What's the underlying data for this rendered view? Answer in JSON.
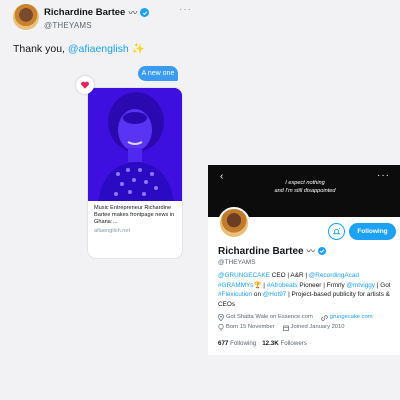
{
  "tweet": {
    "author_name": "Richardine Bartee",
    "author_name_suffix": "〰",
    "author_handle": "@THEYAMS",
    "more_glyph": "···",
    "text_prefix": "Thank you, ",
    "text_mention": "@afiaenglish",
    "text_emoji": "✨"
  },
  "dm": {
    "bubble_text": "A new one",
    "card": {
      "title": "Music Entrepreneur Richardine Bartee makes frontpage news in Ghana:…",
      "domain": "afiaenglish.net"
    }
  },
  "profile": {
    "back_glyph": "‹",
    "more_glyph": "···",
    "banner_line1": "I expect nothing",
    "banner_line2": "and I'm still disappointed",
    "following_label": "Following",
    "name": "Richardine Bartee",
    "name_suffix": "〰",
    "handle": "@THEYAMS",
    "bio": {
      "l1": "@GRUNGECAKE",
      "t1": " CEO | A&R | ",
      "l2": "@RecordingAcad",
      "t2": " ",
      "l3": "#GRAMMYs",
      "t3": "🏆 | ",
      "l4": "#Afrobeats",
      "t4": " Pioneer | Frmrly ",
      "l5": "@mtviggy",
      "t5": " | Got ",
      "l6": "#Flexicution",
      "t6": " on ",
      "l7": "@Hot97",
      "t7": " | Project-based publicity for artists & CEOs"
    },
    "meta": {
      "location": "Got Shatta Wale on Essence.com",
      "website": "grungecake.com",
      "born": "Born 15 November",
      "joined": "Joined January 2010"
    },
    "following_count": "677",
    "following_word": "Following",
    "followers_count": "12.3K",
    "followers_word": "Followers"
  },
  "colors": {
    "accent": "#1da1f2",
    "dm_bubble": "#3a9bf0",
    "photo_tint": "#3e10e0",
    "heart": "#e0245e"
  },
  "icons": [
    "verified-badge-icon",
    "more-icon",
    "heart-icon",
    "back-arrow-icon",
    "notification-bell-icon",
    "location-icon",
    "link-icon",
    "calendar-icon",
    "balloon-icon"
  ]
}
